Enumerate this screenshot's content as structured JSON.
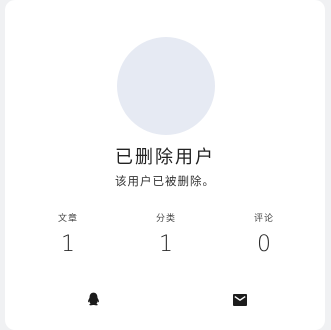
{
  "profile": {
    "name": "已删除用户",
    "bio": "该用户已被删除。"
  },
  "stats": [
    {
      "label": "文章",
      "value": "1"
    },
    {
      "label": "分类",
      "value": "1"
    },
    {
      "label": "评论",
      "value": "0"
    }
  ],
  "social": {
    "qq_icon": "qq-icon",
    "mail_icon": "mail-icon"
  }
}
